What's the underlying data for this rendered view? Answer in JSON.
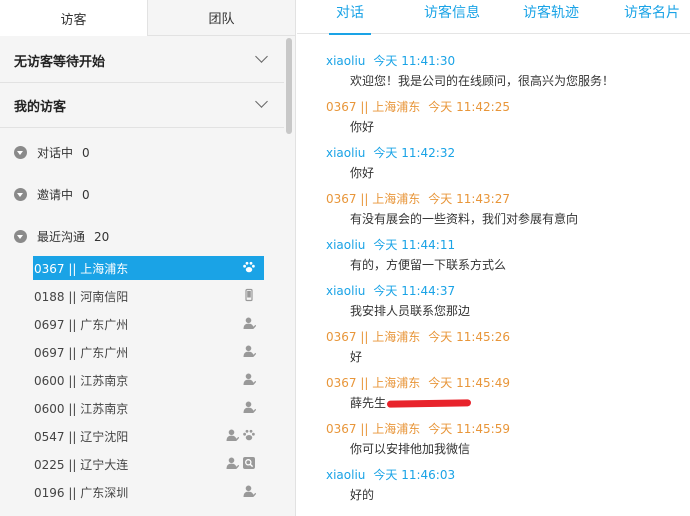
{
  "left_tabs": {
    "visitors": "访客",
    "team": "团队"
  },
  "sections": {
    "waiting": "无访客等待开始",
    "mine": "我的访客"
  },
  "groups": {
    "chatting": {
      "label": "对话中",
      "count": "0"
    },
    "inviting": {
      "label": "邀请中",
      "count": "0"
    },
    "recent": {
      "label": "最近沟通",
      "count": "20"
    }
  },
  "visitors": [
    {
      "label": "0367 || 上海浦东",
      "icons": [
        "paw"
      ]
    },
    {
      "label": "0188 || 河南信阳",
      "icons": [
        "mobile"
      ]
    },
    {
      "label": "0697 || 广东广州",
      "icons": [
        "person"
      ]
    },
    {
      "label": "0697 || 广东广州",
      "icons": [
        "person"
      ]
    },
    {
      "label": "0600 || 江苏南京",
      "icons": [
        "person"
      ]
    },
    {
      "label": "0600 || 江苏南京",
      "icons": [
        "person"
      ]
    },
    {
      "label": "0547 || 辽宁沈阳",
      "icons": [
        "person",
        "paw"
      ]
    },
    {
      "label": "0225 || 辽宁大连",
      "icons": [
        "person",
        "search"
      ]
    },
    {
      "label": "0196 || 广东深圳",
      "icons": [
        "person"
      ]
    }
  ],
  "right_tabs": [
    "对话",
    "访客信息",
    "访客轨迹",
    "访客名片"
  ],
  "messages": [
    {
      "from": "agent",
      "name": "xiaoliu",
      "time": "今天 11:41:30",
      "text": "欢迎您！我是公司的在线顾问，很高兴为您服务！"
    },
    {
      "from": "visitor",
      "name": "0367 || 上海浦东",
      "time": "今天 11:42:25",
      "text": "你好"
    },
    {
      "from": "agent",
      "name": "xiaoliu",
      "time": "今天 11:42:32",
      "text": "你好"
    },
    {
      "from": "visitor",
      "name": "0367 || 上海浦东",
      "time": "今天 11:43:27",
      "text": "有没有展会的一些资料，我们对参展有意向"
    },
    {
      "from": "agent",
      "name": "xiaoliu",
      "time": "今天 11:44:11",
      "text": "有的，方便留一下联系方式么"
    },
    {
      "from": "agent",
      "name": "xiaoliu",
      "time": "今天 11:44:37",
      "text": "我安排人员联系您那边"
    },
    {
      "from": "visitor",
      "name": "0367 || 上海浦东",
      "time": "今天 11:45:26",
      "text": "好"
    },
    {
      "from": "visitor",
      "name": "0367 || 上海浦东",
      "time": "今天 11:45:49",
      "text": "薛先生"
    },
    {
      "from": "visitor",
      "name": "0367 || 上海浦东",
      "time": "今天 11:45:59",
      "text": "你可以安排他加我微信"
    },
    {
      "from": "agent",
      "name": "xiaoliu",
      "time": "今天 11:46:03",
      "text": "好的"
    }
  ],
  "colors": {
    "accent": "#1aa3e6",
    "visitor_name": "#e8963a",
    "redaction": "#e8232b"
  }
}
